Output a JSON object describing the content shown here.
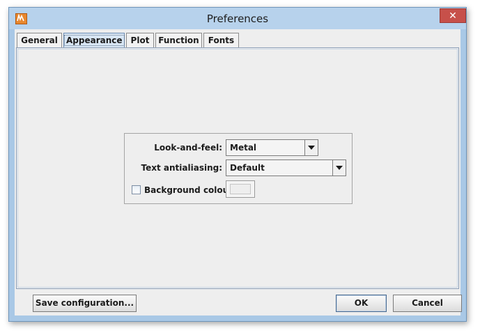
{
  "window": {
    "title": "Preferences",
    "close_glyph": "✕",
    "app_icon": "app-logo-icon"
  },
  "tabs": [
    {
      "label": "General",
      "selected": false
    },
    {
      "label": "Appearance",
      "selected": true
    },
    {
      "label": "Plot",
      "selected": false
    },
    {
      "label": "Function",
      "selected": false
    },
    {
      "label": "Fonts",
      "selected": false
    }
  ],
  "appearance": {
    "look_and_feel": {
      "label": "Look-and-feel:",
      "value": "Metal"
    },
    "text_antialiasing": {
      "label": "Text antialiasing:",
      "value": "Default"
    },
    "background_colour": {
      "label": "Background colour:",
      "checked": false,
      "swatch_color": "#eeeeee"
    }
  },
  "buttons": {
    "save": "Save configuration...",
    "ok": "OK",
    "cancel": "Cancel"
  },
  "colors": {
    "titlebar": "#b7d2ec",
    "close_button": "#c7504a",
    "selected_tab": "#d8e6f4",
    "panel": "#eeeeee"
  }
}
